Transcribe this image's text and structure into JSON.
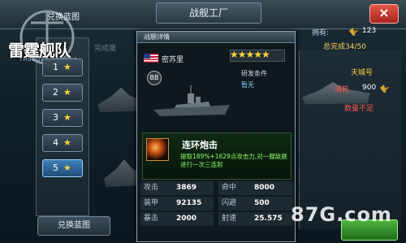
{
  "header": {
    "title": "战舰工厂",
    "close_label": "×",
    "exchange_top": "兑换蓝图",
    "owned_label": "拥有:",
    "owned_count": "123",
    "complete_right": "总完成34/50",
    "complete_left": "完成度"
  },
  "logo": {
    "text": "雷霆舰队",
    "sub": "THUNDER ARMADA"
  },
  "star_tabs": [
    {
      "label": "1",
      "star": "★"
    },
    {
      "label": "2",
      "star": "★"
    },
    {
      "label": "3",
      "star": "★"
    },
    {
      "label": "4",
      "star": "★"
    },
    {
      "label": "5",
      "star": "★"
    }
  ],
  "active_tab": 5,
  "exchange_bottom": "兑换蓝图",
  "right_card": {
    "name": "天城号",
    "consume_label": "消耗",
    "consume_value": "900",
    "insufficient": "数量不足"
  },
  "modal": {
    "title": "战舰详情",
    "ship_name": "密苏里",
    "stars": "★★★★★",
    "class_badge": "BB",
    "research_label": "研发条件",
    "research_value": "暂无",
    "skill": {
      "name": "连环炮击",
      "desc": "提取189%+1629点攻击力,对一艘敌舰进行一次三连射"
    },
    "stats": [
      {
        "l1": "攻击",
        "v1": "3869",
        "l2": "命中",
        "v2": "8000"
      },
      {
        "l1": "装甲",
        "v1": "92135",
        "l2": "闪避",
        "v2": "500"
      },
      {
        "l1": "暴击",
        "v1": "2000",
        "l2": "射速",
        "v2": "25.575"
      }
    ]
  },
  "watermark": "87G.com",
  "colors": {
    "accent_gold": "#ffd23a",
    "warning_red": "#ff5a4a",
    "skill_green": "#8cff6a"
  }
}
